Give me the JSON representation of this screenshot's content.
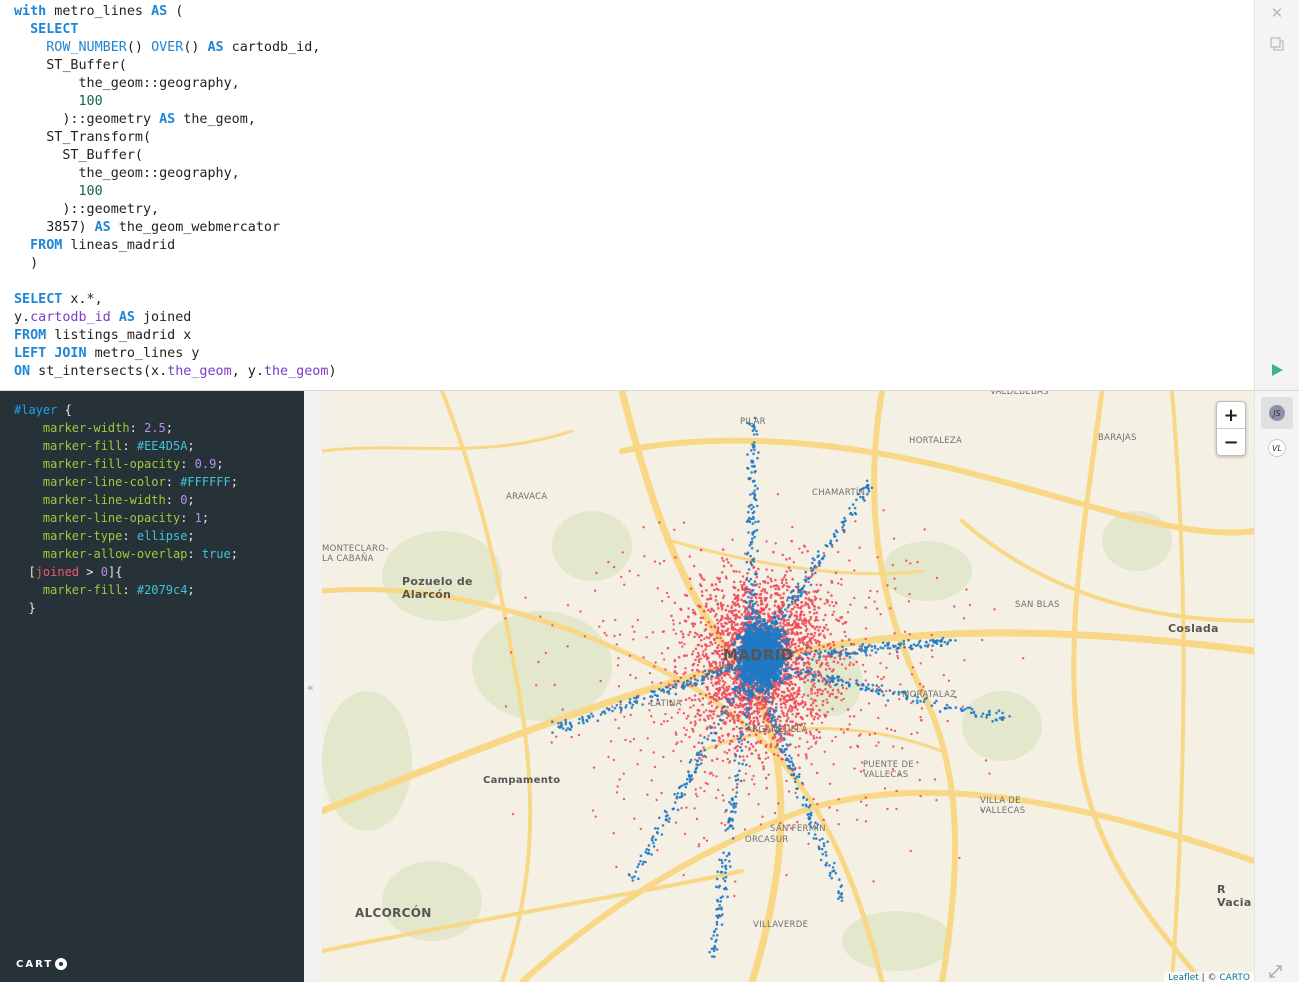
{
  "sql": {
    "lines": [
      [
        {
          "t": "with",
          "c": "kw"
        },
        {
          "t": " metro_lines "
        },
        {
          "t": "AS",
          "c": "kw"
        },
        {
          "t": " ("
        }
      ],
      [
        {
          "t": "  "
        },
        {
          "t": "SELECT",
          "c": "kw"
        }
      ],
      [
        {
          "t": "    "
        },
        {
          "t": "ROW_NUMBER",
          "c": "fn"
        },
        {
          "t": "() "
        },
        {
          "t": "OVER",
          "c": "fn"
        },
        {
          "t": "() "
        },
        {
          "t": "AS",
          "c": "kw"
        },
        {
          "t": " cartodb_id,"
        }
      ],
      [
        {
          "t": "    ST_Buffer("
        }
      ],
      [
        {
          "t": "        the_geom::geography,"
        }
      ],
      [
        {
          "t": "        "
        },
        {
          "t": "100",
          "c": "num"
        }
      ],
      [
        {
          "t": "      )::geometry "
        },
        {
          "t": "AS",
          "c": "kw"
        },
        {
          "t": " the_geom,"
        }
      ],
      [
        {
          "t": "    ST_Transform("
        }
      ],
      [
        {
          "t": "      ST_Buffer("
        }
      ],
      [
        {
          "t": "        the_geom::geography,"
        }
      ],
      [
        {
          "t": "        "
        },
        {
          "t": "100",
          "c": "num"
        }
      ],
      [
        {
          "t": "      )::geometry,"
        }
      ],
      [
        {
          "t": "    3857) "
        },
        {
          "t": "AS",
          "c": "kw"
        },
        {
          "t": " the_geom_webmercator"
        }
      ],
      [
        {
          "t": "  "
        },
        {
          "t": "FROM",
          "c": "kw"
        },
        {
          "t": " lineas_madrid"
        }
      ],
      [
        {
          "t": "  )"
        }
      ],
      [],
      [
        {
          "t": "SELECT",
          "c": "kw"
        },
        {
          "t": " x.*,"
        }
      ],
      [
        {
          "t": "y."
        },
        {
          "t": "cartodb_id",
          "c": "prop"
        },
        {
          "t": " "
        },
        {
          "t": "AS",
          "c": "kw"
        },
        {
          "t": " joined"
        }
      ],
      [
        {
          "t": "FROM",
          "c": "kw"
        },
        {
          "t": " listings_madrid x"
        }
      ],
      [
        {
          "t": "LEFT",
          "c": "kw"
        },
        {
          "t": " "
        },
        {
          "t": "JOIN",
          "c": "kw"
        },
        {
          "t": " metro_lines y"
        }
      ],
      [
        {
          "t": "ON",
          "c": "kw"
        },
        {
          "t": " st_intersects(x."
        },
        {
          "t": "the_geom",
          "c": "prop"
        },
        {
          "t": ", y."
        },
        {
          "t": "the_geom",
          "c": "prop"
        },
        {
          "t": ")"
        }
      ]
    ],
    "toolbar": {
      "close_icon": "close-icon",
      "copy_icon": "copy-icon",
      "run_icon": "play-icon"
    }
  },
  "cartocss": {
    "lines": [
      [
        {
          "t": "#layer",
          "c": "sel"
        },
        {
          "t": " {"
        }
      ],
      [
        {
          "t": "    "
        },
        {
          "t": "marker-width",
          "c": "cprop"
        },
        {
          "t": ": "
        },
        {
          "t": "2.5",
          "c": "cnum"
        },
        {
          "t": ";"
        }
      ],
      [
        {
          "t": "    "
        },
        {
          "t": "marker-fill",
          "c": "cprop"
        },
        {
          "t": ": "
        },
        {
          "t": "#EE4D5A",
          "c": "cval"
        },
        {
          "t": ";"
        }
      ],
      [
        {
          "t": "    "
        },
        {
          "t": "marker-fill-opacity",
          "c": "cprop"
        },
        {
          "t": ": "
        },
        {
          "t": "0.9",
          "c": "cnum"
        },
        {
          "t": ";"
        }
      ],
      [
        {
          "t": "    "
        },
        {
          "t": "marker-line-color",
          "c": "cprop"
        },
        {
          "t": ": "
        },
        {
          "t": "#FFFFFF",
          "c": "cval"
        },
        {
          "t": ";"
        }
      ],
      [
        {
          "t": "    "
        },
        {
          "t": "marker-line-width",
          "c": "cprop"
        },
        {
          "t": ": "
        },
        {
          "t": "0",
          "c": "cnum"
        },
        {
          "t": ";"
        }
      ],
      [
        {
          "t": "    "
        },
        {
          "t": "marker-line-opacity",
          "c": "cprop"
        },
        {
          "t": ": "
        },
        {
          "t": "1",
          "c": "cnum"
        },
        {
          "t": ";"
        }
      ],
      [
        {
          "t": "    "
        },
        {
          "t": "marker-type",
          "c": "cprop"
        },
        {
          "t": ": "
        },
        {
          "t": "ellipse",
          "c": "cval"
        },
        {
          "t": ";"
        }
      ],
      [
        {
          "t": "    "
        },
        {
          "t": "marker-allow-overlap",
          "c": "cprop"
        },
        {
          "t": ": "
        },
        {
          "t": "true",
          "c": "cval"
        },
        {
          "t": ";"
        }
      ],
      [
        {
          "t": "  ["
        },
        {
          "t": "joined",
          "c": "cfield"
        },
        {
          "t": " > "
        },
        {
          "t": "0",
          "c": "cnum"
        },
        {
          "t": "]{"
        }
      ],
      [
        {
          "t": "    "
        },
        {
          "t": "marker-fill",
          "c": "cprop"
        },
        {
          "t": ": "
        },
        {
          "t": "#2079c4",
          "c": "cval"
        },
        {
          "t": ";"
        }
      ],
      [
        {
          "t": "  }"
        }
      ]
    ],
    "logo_text": "CART"
  },
  "map": {
    "labels": [
      {
        "text": "VALDEBEBAS",
        "style": ""
      },
      {
        "text": "PILAR",
        "style": ""
      },
      {
        "text": "HORTALEZA",
        "style": ""
      },
      {
        "text": "BARAJAS",
        "style": ""
      },
      {
        "text": "ARAVACA",
        "style": ""
      },
      {
        "text": "CHAMARTÍN",
        "style": ""
      },
      {
        "text": "MONTECLARO-\nLA CABAÑA",
        "style": ""
      },
      {
        "text": "Pozuelo de\nAlarcón",
        "style": "big"
      },
      {
        "text": "SAN BLAS",
        "style": ""
      },
      {
        "text": "Coslada",
        "style": "big"
      },
      {
        "text": "MADRID",
        "style": "center"
      },
      {
        "text": "LATINA",
        "style": ""
      },
      {
        "text": "MORATALAZ",
        "style": ""
      },
      {
        "text": "ARGANZUELA",
        "style": ""
      },
      {
        "text": "Campamento",
        "style": "big small"
      },
      {
        "text": "PUENTE DE\nVALLECAS",
        "style": ""
      },
      {
        "text": "VILLA DE\nVALLECAS",
        "style": ""
      },
      {
        "text": "SAN FERMÍN",
        "style": ""
      },
      {
        "text": "ORCASUR",
        "style": ""
      },
      {
        "text": "ALCORCÓN",
        "style": "caps-big"
      },
      {
        "text": "VILLAVERDE",
        "style": ""
      },
      {
        "text": "R\nVacia",
        "style": "big"
      }
    ],
    "zoom_in_label": "+",
    "zoom_out_label": "−",
    "attribution_leaflet": "Leaflet",
    "attribution_sep": " | © ",
    "attribution_carto": "CARTO",
    "colors": {
      "background": "#f5f0e4",
      "roads": "#f7d67e",
      "parks": "#dfe5c6",
      "fill": "#EE4D5A",
      "joined_fill": "#2079c4"
    }
  },
  "sidebar": {
    "collapse_label": "«",
    "mode_js": "JS",
    "mode_vl": "VL",
    "expand_icon": "expand-icon"
  }
}
